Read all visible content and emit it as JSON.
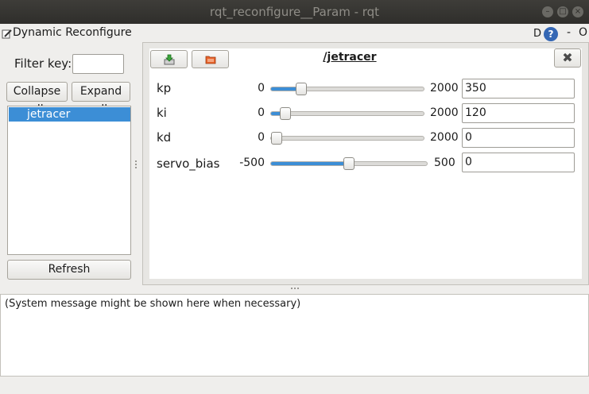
{
  "window": {
    "title": "rqt_reconfigure__Param - rqt"
  },
  "plugin": {
    "title": "Dynamic Reconfigure",
    "help_d": "D",
    "help_q": "?",
    "dash": "-",
    "o": "O"
  },
  "left": {
    "filter_label": "Filter key:",
    "filter_value": "",
    "collapse_label": "Collapse all",
    "expand_label": "Expand all",
    "tree_items": [
      "jetracer"
    ],
    "refresh_label": "Refresh"
  },
  "node": {
    "title": "/jetracer",
    "close_symbol": "✖"
  },
  "params": [
    {
      "name": "kp",
      "min": "0",
      "max": "2000",
      "value": "350",
      "fraction": 0.175
    },
    {
      "name": "ki",
      "min": "0",
      "max": "2000",
      "value": "120",
      "fraction": 0.06
    },
    {
      "name": "kd",
      "min": "0",
      "max": "2000",
      "value": "0",
      "fraction": 0.0
    },
    {
      "name": "servo_bias",
      "min": "-500",
      "max": "500",
      "value": "0",
      "fraction": 0.5
    }
  ],
  "system_message": "(System message might be shown here when necessary)",
  "colors": {
    "accent": "#3c8ed6",
    "titlebar": "#2f2e2b"
  }
}
